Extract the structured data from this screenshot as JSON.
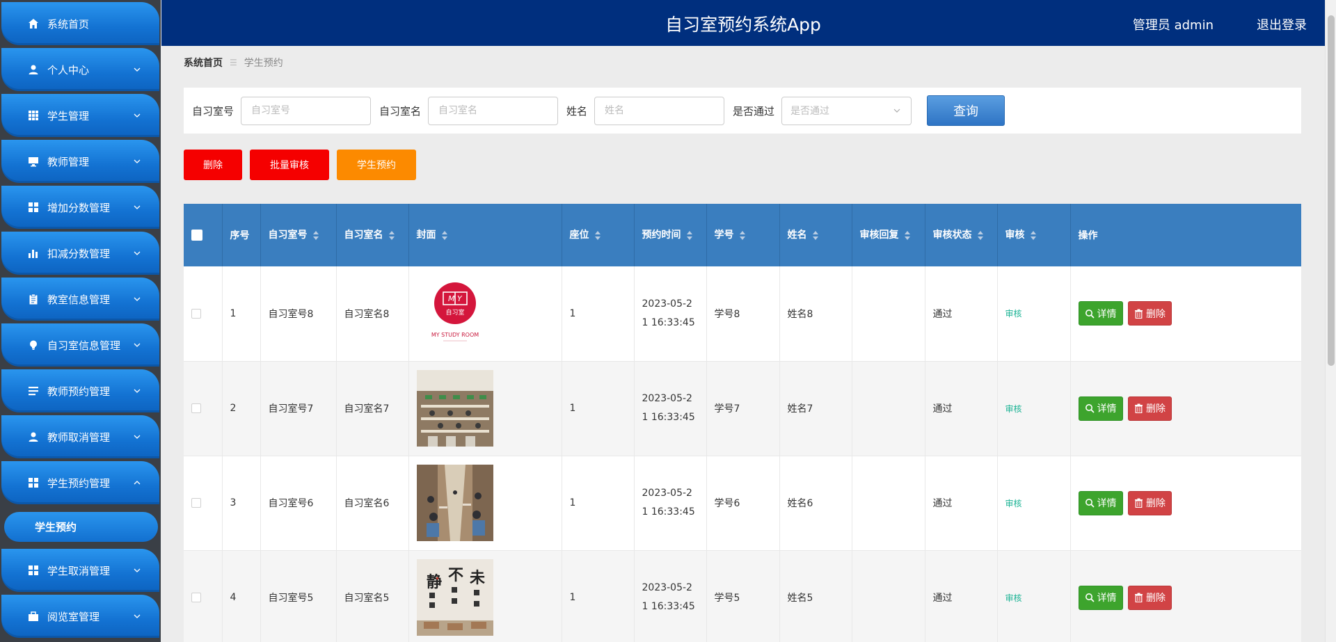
{
  "app": {
    "title": "自习室预约系统App",
    "admin_label": "管理员 admin",
    "logout": "退出登录"
  },
  "sidebar": {
    "items": [
      {
        "label": "系统首页",
        "icon": "home-icon",
        "expandable": false
      },
      {
        "label": "个人中心",
        "icon": "user-icon",
        "expandable": true
      },
      {
        "label": "学生管理",
        "icon": "grid-icon",
        "expandable": true
      },
      {
        "label": "教师管理",
        "icon": "monitor-icon",
        "expandable": true
      },
      {
        "label": "增加分数管理",
        "icon": "apps-icon",
        "expandable": true
      },
      {
        "label": "扣减分数管理",
        "icon": "bar-chart-icon",
        "expandable": true
      },
      {
        "label": "教室信息管理",
        "icon": "clipboard-icon",
        "expandable": true
      },
      {
        "label": "自习室信息管理",
        "icon": "bulb-icon",
        "expandable": true
      },
      {
        "label": "教师预约管理",
        "icon": "list-icon",
        "expandable": true
      },
      {
        "label": "教师取消管理",
        "icon": "user-icon",
        "expandable": true
      },
      {
        "label": "学生预约管理",
        "icon": "apps-icon",
        "expandable": true,
        "expanded": true
      },
      {
        "label": "学生取消管理",
        "icon": "apps-icon",
        "expandable": true
      },
      {
        "label": "阅览室管理",
        "icon": "briefcase-icon",
        "expandable": true
      }
    ],
    "active_sub": "学生预约"
  },
  "breadcrumb": {
    "home": "系统首页",
    "separator": "☰",
    "current": "学生预约"
  },
  "search": {
    "room_no_label": "自习室号",
    "room_no_placeholder": "自习室号",
    "room_name_label": "自习室名",
    "room_name_placeholder": "自习室名",
    "name_label": "姓名",
    "name_placeholder": "姓名",
    "approved_label": "是否通过",
    "approved_placeholder": "是否通过",
    "query_button": "查询"
  },
  "actions": {
    "delete": "删除",
    "batch_audit": "批量审核",
    "student_reserve": "学生预约"
  },
  "table": {
    "headers": {
      "index": "序号",
      "room_no": "自习室号",
      "room_name": "自习室名",
      "cover": "封面",
      "seat": "座位",
      "time": "预约时间",
      "student_no": "学号",
      "name": "姓名",
      "reply": "审核回复",
      "status": "审核状态",
      "audit": "审核",
      "ops": "操作"
    },
    "detail_label": "详情",
    "delete_label": "删除",
    "rows": [
      {
        "index": "1",
        "room_no": "自习室号8",
        "room_name": "自习室名8",
        "seat": "1",
        "time_line1": "2023-05-2",
        "time_line2": "1 16:33:45",
        "student_no": "学号8",
        "name": "姓名8",
        "reply": "",
        "status": "通过",
        "audit": "审核",
        "cover_text": "MY STUDY ROOM",
        "cover_badge": "自习室"
      },
      {
        "index": "2",
        "room_no": "自习室号7",
        "room_name": "自习室名7",
        "seat": "1",
        "time_line1": "2023-05-2",
        "time_line2": "1 16:33:45",
        "student_no": "学号7",
        "name": "姓名7",
        "reply": "",
        "status": "通过",
        "audit": "审核"
      },
      {
        "index": "3",
        "room_no": "自习室号6",
        "room_name": "自习室名6",
        "seat": "1",
        "time_line1": "2023-05-2",
        "time_line2": "1 16:33:45",
        "student_no": "学号6",
        "name": "姓名6",
        "reply": "",
        "status": "通过",
        "audit": "审核"
      },
      {
        "index": "4",
        "room_no": "自习室号5",
        "room_name": "自习室名5",
        "seat": "1",
        "time_line1": "2023-05-2",
        "time_line2": "1 16:33:45",
        "student_no": "学号5",
        "name": "姓名5",
        "reply": "",
        "status": "通过",
        "audit": "审核",
        "cover_chars": [
          "静",
          "不",
          "未"
        ]
      }
    ]
  },
  "colors": {
    "header_bg": "#002f7e",
    "sidebar_item": "#1372d2",
    "table_header": "#3a7ebf",
    "danger": "#f50000",
    "warning": "#fc8a00",
    "success": "#3da42d",
    "audit_link": "#1bb394"
  }
}
